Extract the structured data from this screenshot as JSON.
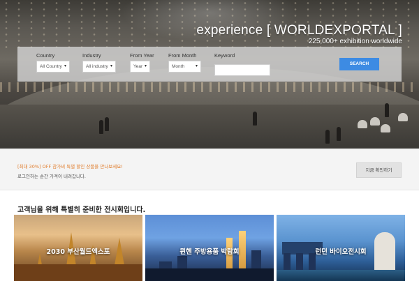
{
  "hero": {
    "title": "experience [ WORLDEXPORTAL ]",
    "subtitle": "225,000+ exhibition worldwide"
  },
  "search": {
    "country_label": "Country",
    "country_value": "All Country",
    "industry_label": "Industry",
    "industry_value": "All industry",
    "from_year_label": "From Year",
    "from_year_value": "Year",
    "from_month_label": "From Month",
    "from_month_value": "Month",
    "keyword_label": "Keyword",
    "keyword_value": "",
    "button_label": "SEARCH",
    "accent_color": "#3d8be3"
  },
  "promo": {
    "line1": "[최대 30%] OFF 참가비 특별 할인 상품을 만나보세요!",
    "line2": "로그인하는 순간 가격이 내려갑니다.",
    "button_label": "지금 확인하기",
    "accent_color": "#e07b2a"
  },
  "section": {
    "title": "고객님을 위해 특별히 준비한 전시회입니다.",
    "cards": [
      {
        "title": "2030 부산월드엑스포"
      },
      {
        "title": "뮌헨 주방용품 박람회"
      },
      {
        "title": "런던 바이오전시회"
      }
    ]
  },
  "icons": {
    "dropdown": "caret-down-icon"
  }
}
